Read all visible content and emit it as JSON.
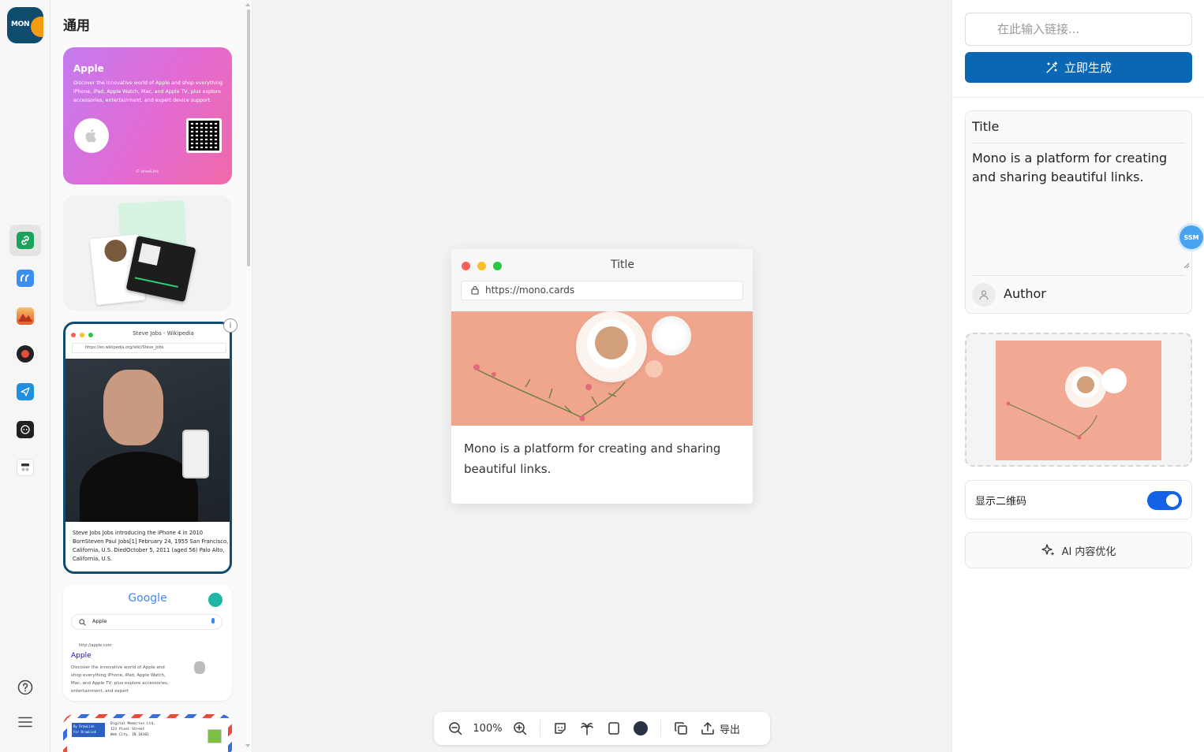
{
  "app": {
    "logo_text": "MON"
  },
  "rail": {
    "items": [
      {
        "name": "link",
        "color": "#1aa35c"
      },
      {
        "name": "quote",
        "color": "#3b8ff0"
      },
      {
        "name": "photo",
        "color": "#e55a2b"
      },
      {
        "name": "record",
        "color": "#c0392b"
      },
      {
        "name": "send",
        "color": "#1f8fe0"
      },
      {
        "name": "bot",
        "color": "#222222"
      },
      {
        "name": "layout",
        "color": "#555555"
      }
    ],
    "help_icon": "help-circle-icon",
    "menu_icon": "hamburger-icon"
  },
  "gallery": {
    "title": "通用",
    "apple_card": {
      "title": "Apple",
      "description": "Discover the innovative world of Apple and shop everything iPhone, iPad, Apple Watch, Mac, and Apple TV, plus explore accessories, entertainment, and expert device support.",
      "footer": "© drawLink"
    },
    "wiki_card": {
      "title": "Steve Jobs - Wikipedia",
      "url": "https://en.wikipedia.org/wiki/Steve_Jobs",
      "text": "Steve Jobs Jobs introducing the iPhone 4 in 2010 BornSteven Paul Jobs[1] February 24, 1955 San Francisco, California, U.S. DiedOctober 5, 2011 (aged 56) Palo Alto, California, U.S."
    },
    "google_card": {
      "logo": "Google",
      "query": "Apple",
      "result_url": "http://apple.com",
      "result_title": "Apple",
      "result_snippet": "Discover the innovative world of Apple and shop everything iPhone, iPad, Apple Watch, Mac, and Apple TV, plus explore accessories, entertainment, and expert"
    },
    "letter_card": {
      "stamp_line1": "By DrawLink",
      "stamp_line2": "For DrawLink",
      "address1": "Digital Memories Ltd.",
      "address2": "123 Pixel Street",
      "address3": "Web City, IN 10101"
    }
  },
  "canvas": {
    "card": {
      "title": "Title",
      "url": "https://mono.cards",
      "description": "Mono is a platform for creating and sharing beautiful links."
    },
    "toolbar": {
      "zoom": "100%",
      "export_label": "导出"
    }
  },
  "panel": {
    "link_placeholder": "在此输入链接...",
    "generate_label": "立即生成",
    "editor": {
      "title": "Title",
      "body": "Mono is a platform for creating and sharing beautiful links.",
      "author": "Author"
    },
    "ssm_badge": "SSM",
    "qr_toggle_label": "显示二维码",
    "qr_toggle_on": true,
    "ai_button_label": "AI 内容优化",
    "accent": "#0b66b3"
  }
}
